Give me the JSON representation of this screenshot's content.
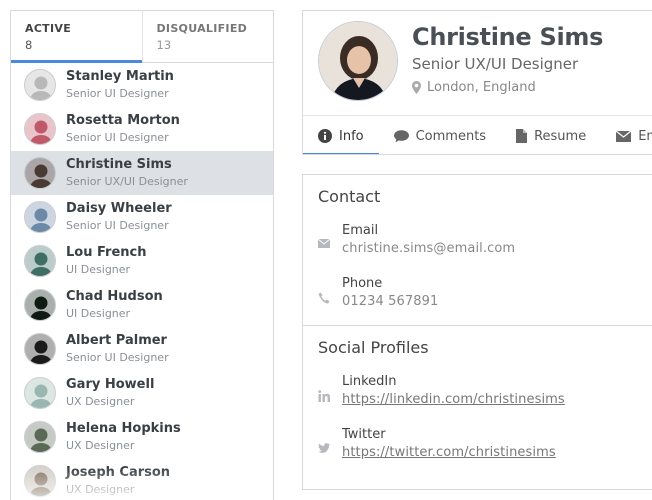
{
  "list_tabs": [
    {
      "label": "ACTIVE",
      "count": "8"
    },
    {
      "label": "DISQUALIFIED",
      "count": "13"
    }
  ],
  "people": [
    {
      "name": "Stanley Martin",
      "title": "Senior UI Designer",
      "avatar_color": "#b8b8b8"
    },
    {
      "name": "Rosetta Morton",
      "title": "Senior UI Designer",
      "avatar_color": "#c05a6a"
    },
    {
      "name": "Christine Sims",
      "title": "Senior UX/UI Designer",
      "avatar_color": "#4a3a34"
    },
    {
      "name": "Daisy Wheeler",
      "title": "Senior UI Designer",
      "avatar_color": "#6c8aa8"
    },
    {
      "name": "Lou French",
      "title": "UI Designer",
      "avatar_color": "#3e6e66"
    },
    {
      "name": "Chad Hudson",
      "title": "UI Designer",
      "avatar_color": "#0e1a12"
    },
    {
      "name": "Albert Palmer",
      "title": "Senior UI Designer",
      "avatar_color": "#1a1a1a"
    },
    {
      "name": "Gary Howell",
      "title": "UX Designer",
      "avatar_color": "#9ab6b0"
    },
    {
      "name": "Helena Hopkins",
      "title": "UX Designer",
      "avatar_color": "#5a6a56"
    },
    {
      "name": "Joseph Carson",
      "title": "UX Designer",
      "avatar_color": "#8a7a6a"
    }
  ],
  "profile": {
    "name": "Christine Sims",
    "role": "Senior UX/UI Designer",
    "location": "London, England"
  },
  "detail_tabs": [
    {
      "label": "Info",
      "icon": "info-icon"
    },
    {
      "label": "Comments",
      "icon": "comment-icon"
    },
    {
      "label": "Resume",
      "icon": "file-icon"
    },
    {
      "label": "Em",
      "icon": "envelope-icon"
    }
  ],
  "contact": {
    "title": "Contact",
    "email_label": "Email",
    "email_value": "christine.sims@email.com",
    "phone_label": "Phone",
    "phone_value": "01234 567891"
  },
  "social": {
    "title": "Social Profiles",
    "linkedin_label": "LinkedIn",
    "linkedin_value": "https://linkedin.com/christinesims",
    "twitter_label": "Twitter",
    "twitter_value": "https://twitter.com/christinesims"
  },
  "colors": {
    "accent": "#4a8ad8",
    "selected_row": "#dde1e6"
  }
}
